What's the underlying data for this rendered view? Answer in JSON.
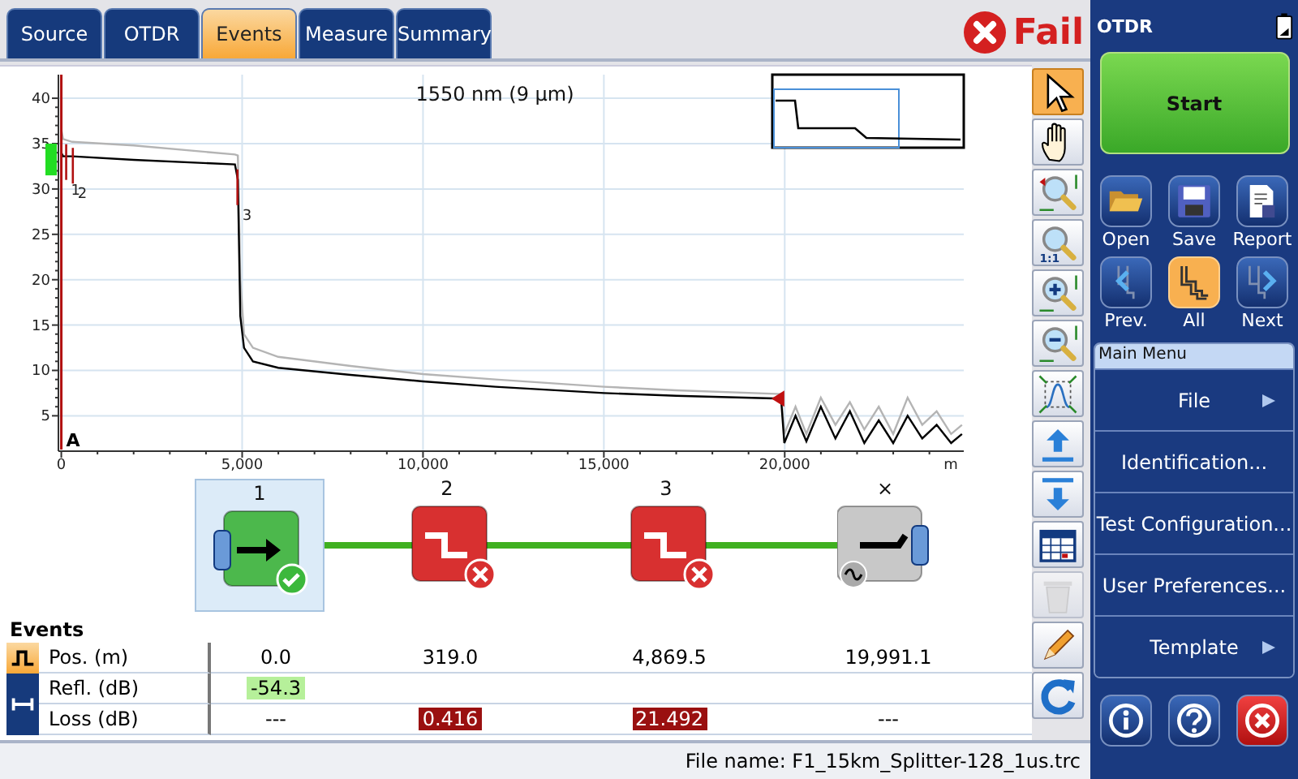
{
  "tabs": [
    {
      "label": "Source",
      "selected": false
    },
    {
      "label": "OTDR",
      "selected": false
    },
    {
      "label": "Events",
      "selected": true
    },
    {
      "label": "Measure",
      "selected": false
    },
    {
      "label": "Summary",
      "selected": false
    }
  ],
  "result": {
    "failed": true,
    "label": "Fail"
  },
  "chart": {
    "chart_data": {
      "type": "line",
      "title": "1550 nm (9 µm)",
      "xlabel": "m",
      "grid": true,
      "x": [
        0,
        50,
        300,
        2000,
        4800,
        4880,
        4950,
        5050,
        5300,
        6000,
        8000,
        10000,
        12000,
        15000,
        17000,
        19900,
        19990,
        20300,
        20600,
        21000,
        21400,
        21800,
        22200,
        22600,
        23000,
        23400,
        23800,
        24200,
        24600,
        24900
      ],
      "series": [
        {
          "color": "#b4b4b4",
          "values": [
            36.5,
            35.5,
            35.2,
            34.8,
            33.8,
            33.7,
            20,
            14,
            12.5,
            11.5,
            10.5,
            9.6,
            9,
            8.2,
            7.8,
            7.4,
            3,
            6,
            3,
            7,
            4,
            6.5,
            3.5,
            6,
            3,
            7,
            4,
            5.5,
            3,
            4
          ]
        },
        {
          "color": "#000000",
          "values": [
            34,
            33.6,
            33.6,
            33.2,
            32.7,
            31,
            16,
            12.5,
            11,
            10.3,
            9.5,
            8.8,
            8.2,
            7.5,
            7.2,
            6.9,
            2,
            5,
            2.2,
            6,
            2.5,
            5.5,
            2,
            4.5,
            2,
            5,
            2.5,
            4,
            2,
            3
          ]
        }
      ],
      "xlim": [
        -80,
        24950
      ],
      "ylim": [
        1.1,
        42.6
      ],
      "xticks": [
        0,
        {
          "value": 5000,
          "label": "5,000"
        },
        {
          "value": 10000,
          "label": "10,000"
        },
        {
          "value": 15000,
          "label": "15,000"
        },
        {
          "value": 20000,
          "label": "20,000"
        }
      ],
      "yticks": [
        5,
        10,
        15,
        20,
        25,
        30,
        35,
        40
      ],
      "annotations": [
        "A",
        "1",
        "2",
        "3"
      ]
    }
  },
  "tools": [
    {
      "kind": "pointer",
      "selected": true,
      "disabled": false
    },
    {
      "kind": "pan",
      "selected": false,
      "disabled": false
    },
    {
      "kind": "zoom-area",
      "selected": false,
      "disabled": false
    },
    {
      "kind": "zoom-reset",
      "label": "1:1",
      "selected": false,
      "disabled": false
    },
    {
      "kind": "zoom-in",
      "selected": false,
      "disabled": false
    },
    {
      "kind": "zoom-out",
      "selected": false,
      "disabled": false
    },
    {
      "kind": "fit",
      "selected": false,
      "disabled": false
    },
    {
      "kind": "up",
      "selected": false,
      "disabled": false
    },
    {
      "kind": "down",
      "selected": false,
      "disabled": false
    },
    {
      "kind": "table",
      "selected": false,
      "disabled": false
    },
    {
      "kind": "delete",
      "selected": false,
      "disabled": true
    },
    {
      "kind": "edit",
      "selected": false,
      "disabled": false
    },
    {
      "kind": "refresh",
      "selected": false,
      "disabled": false
    }
  ],
  "events": [
    {
      "label": "1",
      "kind": "launch",
      "passed": true,
      "failed": false,
      "selected": true
    },
    {
      "label": "2",
      "kind": "loss",
      "passed": false,
      "failed": true,
      "selected": false
    },
    {
      "label": "3",
      "kind": "loss",
      "passed": false,
      "failed": true,
      "selected": false
    },
    {
      "label": "×",
      "kind": "end",
      "passed": false,
      "failed": false,
      "selected": false
    }
  ],
  "table": {
    "title": "Events",
    "rows": [
      {
        "label": "Pos. (m)",
        "cells": [
          {
            "text": "0.0",
            "passed": false,
            "failed": false
          },
          {
            "text": "319.0",
            "passed": false,
            "failed": false
          },
          {
            "text": "4,869.5",
            "passed": false,
            "failed": false
          },
          {
            "text": "19,991.1",
            "passed": false,
            "failed": false
          }
        ]
      },
      {
        "label": "Refl. (dB)",
        "cells": [
          {
            "text": "-54.3",
            "passed": true,
            "failed": false
          },
          null,
          null,
          null
        ]
      },
      {
        "label": "Loss (dB)",
        "cells": [
          {
            "text": "---",
            "passed": false,
            "failed": false
          },
          {
            "text": "0.416",
            "passed": false,
            "failed": true
          },
          {
            "text": "21.492",
            "passed": false,
            "failed": true
          },
          {
            "text": "---",
            "passed": false,
            "failed": false
          }
        ]
      }
    ]
  },
  "status_bar": {
    "file": "File name: F1_15km_Splitter-128_1us.trc"
  },
  "side": {
    "title": "OTDR",
    "start": "Start",
    "buttons": [
      {
        "kind": "open",
        "label": "Open",
        "selected": false
      },
      {
        "kind": "save",
        "label": "Save",
        "selected": false
      },
      {
        "kind": "report",
        "label": "Report",
        "selected": false
      },
      {
        "kind": "prev",
        "label": "Prev.",
        "selected": false
      },
      {
        "kind": "all",
        "label": "All",
        "selected": true
      },
      {
        "kind": "next",
        "label": "Next",
        "selected": false
      }
    ],
    "menu_title": "Main Menu",
    "menu": [
      {
        "label": "File",
        "submenu": true
      },
      {
        "label": "Identification...",
        "submenu": false
      },
      {
        "label": "Test Configuration...",
        "submenu": false
      },
      {
        "label": "User Preferences...",
        "submenu": false
      },
      {
        "label": "Template",
        "submenu": true
      }
    ],
    "bottom": [
      {
        "kind": "info"
      },
      {
        "kind": "help"
      },
      {
        "kind": "exit"
      }
    ]
  }
}
